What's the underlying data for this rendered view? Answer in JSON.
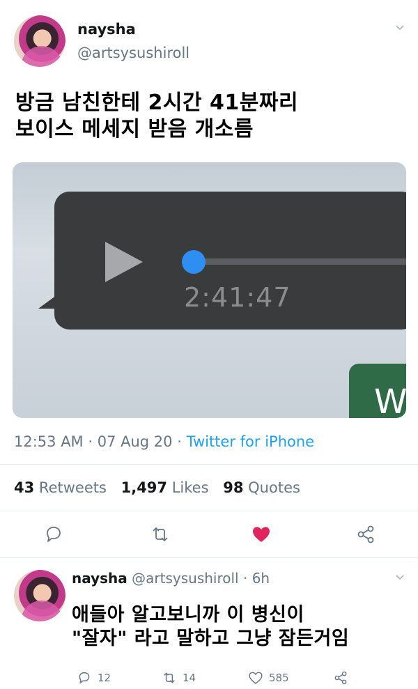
{
  "tweet": {
    "display_name": "naysha",
    "handle": "@artsysushiroll",
    "text_line1": "방금 남친한테 2시간 41분짜리",
    "text_line2": "보이스 메세지 받음 개소름",
    "media": {
      "duration": "2:41:47",
      "partial_letter": "W"
    },
    "time": "12:53 AM",
    "date": "07 Aug 20",
    "source": "Twitter for iPhone",
    "retweets_count": "43",
    "retweets_label": "Retweets",
    "likes_count": "1,497",
    "likes_label": "Likes",
    "quotes_count": "98",
    "quotes_label": "Quotes",
    "liked_color": "#e0245e"
  },
  "reply": {
    "display_name": "naysha",
    "handle": "@artsysushiroll",
    "age": "6h",
    "text_line1": "애들아 알고보니까 이 병신이",
    "text_line2": "\"잘자\" 라고 말하고 그냥 잠든거임",
    "reply_count": "12",
    "retweet_count": "14",
    "like_count": "585"
  },
  "icons": [
    "chevron-down-icon",
    "play-icon",
    "reply-icon",
    "retweet-icon",
    "heart-icon",
    "share-icon"
  ]
}
